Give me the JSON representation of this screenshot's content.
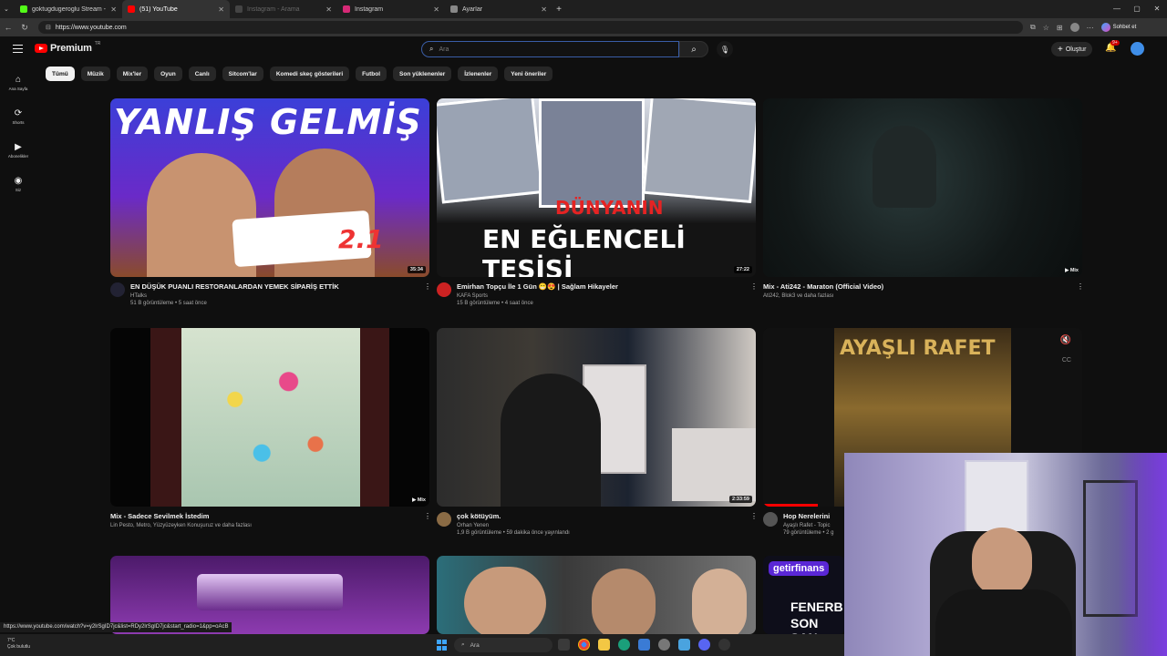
{
  "browser": {
    "tabs": [
      {
        "title": "goktugdugeroglu Stream - Watch",
        "color": "#53fc18",
        "active": false,
        "dim": false
      },
      {
        "title": "(51) YouTube",
        "color": "#ff0000",
        "active": true,
        "dim": false
      },
      {
        "title": "Instagram - Arama",
        "color": "#444444",
        "active": false,
        "dim": true
      },
      {
        "title": "Instagram",
        "color": "#d62976",
        "active": false,
        "dim": false
      },
      {
        "title": "Ayarlar",
        "color": "#888888",
        "active": false,
        "dim": false
      }
    ],
    "url": "https://www.youtube.com",
    "sohbet_label": "Sohbet et"
  },
  "youtube": {
    "logo_text": "Premium",
    "logo_region": "TR",
    "search_placeholder": "Ara",
    "create_label": "Oluştur",
    "notification_count": "9+",
    "sidebar": [
      {
        "icon": "⌂",
        "label": "Ana Sayfa",
        "name": "home"
      },
      {
        "icon": "⟳",
        "label": "Shorts",
        "name": "shorts"
      },
      {
        "icon": "▶",
        "label": "Abonelikler",
        "name": "subscriptions"
      },
      {
        "icon": "◉",
        "label": "Siz",
        "name": "you"
      }
    ],
    "chips": [
      "Tümü",
      "Müzik",
      "Mix'ler",
      "Oyun",
      "Canlı",
      "Sitcom'lar",
      "Komedi skeç gösterileri",
      "Futbol",
      "Son yüklenenler",
      "İzlenenler",
      "Yeni öneriler"
    ],
    "videos": [
      {
        "title": "EN DÜŞÜK PUANLI RESTORANLARDAN YEMEK SİPARİŞ ETTİK",
        "channel": "HTalks",
        "stats": "51 B görüntüleme • 5 saat önce",
        "duration": "35:34",
        "thumb_text": "YANLIŞ GELMİŞ",
        "thumb_sub": "2.1"
      },
      {
        "title": "Emirhan Topçu İle 1 Gün 😁😍 | Sağlam Hikayeler",
        "channel": "KAFA Sports",
        "stats": "15 B görüntüleme • 4 saat önce",
        "duration": "27:22",
        "thumb_text": "DÜNYANIN",
        "thumb_sub": "EN EĞLENCELİ TESİSİ"
      },
      {
        "title": "Mix - Ati242 - Maraton (Official Video)",
        "channel": "Ati242, Blok3 ve daha fazlası",
        "stats": "",
        "duration": "▶ Mix"
      },
      {
        "title": "Mix - Sadece Sevilmek İstedim",
        "channel": "Lin Pesto, Metro, Yüzyüzeyken Konuşuruz ve daha fazlası",
        "stats": "",
        "duration": "▶ Mix"
      },
      {
        "title": "çok kötüyüm.",
        "channel": "Orhan Yenen",
        "stats": "1,9 B görüntüleme • 59 dakika önce yayınlandı",
        "duration": "2:33:59"
      },
      {
        "title": "Hop Nerelerini",
        "channel": "Ayaşlı Rafet - Topic",
        "stats": "79 görüntüleme • 2 g",
        "duration": "",
        "thumb_text": "AYAŞLI RAFET"
      }
    ],
    "row3_text": {
      "getir": "getirfinans",
      "fener": "FENERB",
      "son": "SON SAN"
    }
  },
  "status_url": "https://www.youtube.com/watch?v=y2lrSgID7jc&list=RDy2lrSgID7jc&start_radio=1&pp=oAcB",
  "taskbar": {
    "weather_temp": "7°C",
    "weather_desc": "Çok bulutlu",
    "search_label": "Ara"
  },
  "colors": {
    "yt_red": "#ff0000",
    "accent_blue": "#3ea6ff"
  }
}
